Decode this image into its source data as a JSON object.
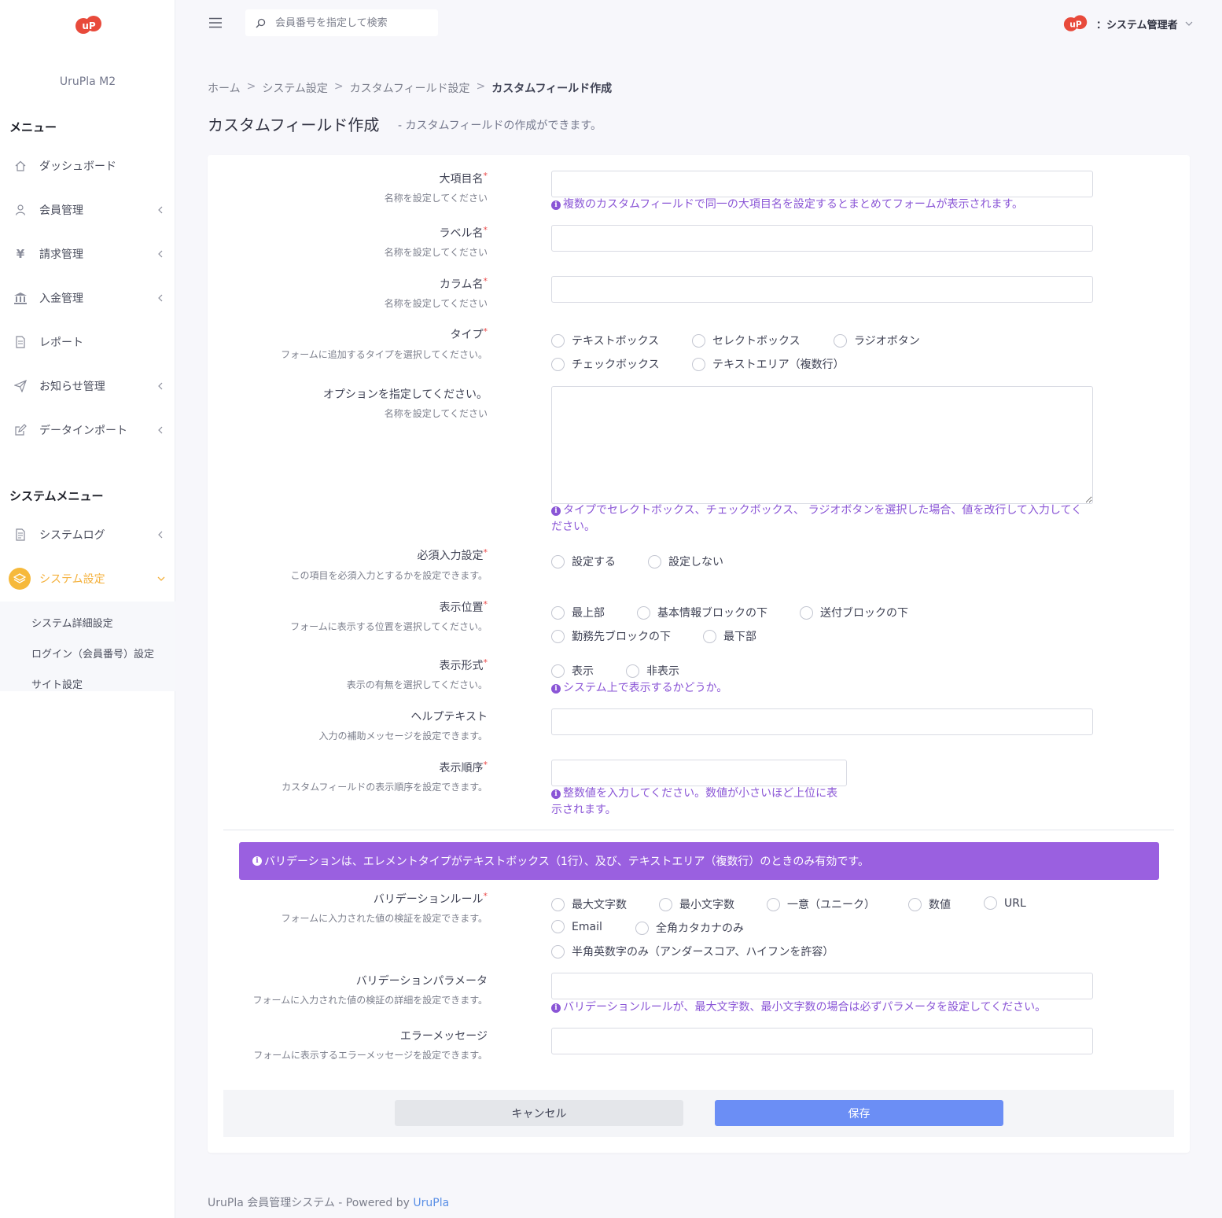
{
  "app": {
    "brand": "UruPla M2",
    "user_name": "：システム管理者",
    "search_placeholder": "会員番号を指定して検索"
  },
  "sidebar": {
    "menu_title": "メニュー",
    "items": [
      {
        "label": "ダッシュボード",
        "icon": "home-icon"
      },
      {
        "label": "会員管理",
        "icon": "user-icon"
      },
      {
        "label": "請求管理",
        "icon": "yen-icon"
      },
      {
        "label": "入金管理",
        "icon": "bank-icon"
      },
      {
        "label": "レポート",
        "icon": "document-icon"
      },
      {
        "label": "お知らせ管理",
        "icon": "paper-plane-icon"
      },
      {
        "label": "データインポート",
        "icon": "edit-icon"
      }
    ],
    "system_title": "システムメニュー",
    "system_items": [
      {
        "label": "システムログ",
        "icon": "log-icon"
      },
      {
        "label": "システム設定",
        "icon": "layers-icon"
      }
    ],
    "sub_items": [
      "システム詳細設定",
      "ログイン（会員番号）設定",
      "サイト設定"
    ]
  },
  "breadcrumb": [
    "ホーム",
    "システム設定",
    "カスタムフィールド設定",
    "カスタムフィールド作成"
  ],
  "page": {
    "title": "カスタムフィールド作成",
    "subtitle": "- カスタムフィールドの作成ができます。"
  },
  "form": {
    "required_mark": "*",
    "major_item": {
      "label": "大項目名",
      "hint": "名称を設定してください",
      "value": "",
      "note": "複数のカスタムフィールドで同一の大項目名を設定するとまとめてフォームが表示されます。"
    },
    "label_name": {
      "label": "ラベル名",
      "hint": "名称を設定してください",
      "value": ""
    },
    "column_name": {
      "label": "カラム名",
      "hint": "名称を設定してください",
      "value": ""
    },
    "type": {
      "label": "タイプ",
      "hint": "フォームに追加するタイプを選択してください。",
      "options": [
        "テキストボックス",
        "セレクトボックス",
        "ラジオボタン",
        "チェックボックス",
        "テキストエリア（複数行）"
      ]
    },
    "options": {
      "label": "オプションを指定してください。",
      "hint": "名称を設定してください",
      "value": "",
      "note_line1": "タイプでセレクトボックス、チェックボックス、 ラジオボタンを選択した場合、値を改行して入力してく",
      "note_line2": "ださい。"
    },
    "required": {
      "label": "必須入力設定",
      "hint": "この項目を必須入力とするかを設定できます。",
      "options": [
        "設定する",
        "設定しない"
      ]
    },
    "position": {
      "label": "表示位置",
      "hint": "フォームに表示する位置を選択してください。",
      "options": [
        "最上部",
        "基本情報ブロックの下",
        "送付ブロックの下",
        "勤務先ブロックの下",
        "最下部"
      ]
    },
    "display": {
      "label": "表示形式",
      "hint": "表示の有無を選択してください。",
      "options": [
        "表示",
        "非表示"
      ],
      "note": "システム上で表示するかどうか。"
    },
    "help_text": {
      "label": "ヘルプテキスト",
      "hint": "入力の補助メッセージを設定できます。",
      "value": ""
    },
    "order": {
      "label": "表示順序",
      "hint": "カスタムフィールドの表示順序を設定できます。",
      "value": "",
      "note_line1": "整数値を入力してください。数値が小さいほど上位に表",
      "note_line2": "示されます。"
    },
    "validation_alert": "バリデーションは、エレメントタイプがテキストボックス（1行）、及び、テキストエリア（複数行）のときのみ有効です。",
    "validation_rule": {
      "label": "バリデーションルール",
      "hint": "フォームに入力された値の検証を設定できます。",
      "options": [
        "最大文字数",
        "最小文字数",
        "一意（ユニーク）",
        "数値",
        "URL",
        "Email",
        "全角カタカナのみ",
        "半角英数字のみ（アンダースコア、ハイフンを許容）"
      ]
    },
    "validation_param": {
      "label": "バリデーションパラメータ",
      "hint": "フォームに入力された値の検証の詳細を設定できます。",
      "value": "",
      "note": "バリデーションルールが、最大文字数、最小文字数の場合は必ずパラメータを設定してください。"
    },
    "error_message": {
      "label": "エラーメッセージ",
      "hint": "フォームに表示するエラーメッセージを設定できます。",
      "value": ""
    },
    "cancel_label": "キャンセル",
    "save_label": "保存"
  },
  "footer": {
    "text": "UruPla 会員管理システム - Powered by ",
    "link": "UruPla"
  },
  "colors": {
    "accent": "#f6b93b",
    "note": "#8a55d6",
    "alert": "#9a60e0",
    "save": "#6b8ef5",
    "logo": "#e84a3b"
  }
}
